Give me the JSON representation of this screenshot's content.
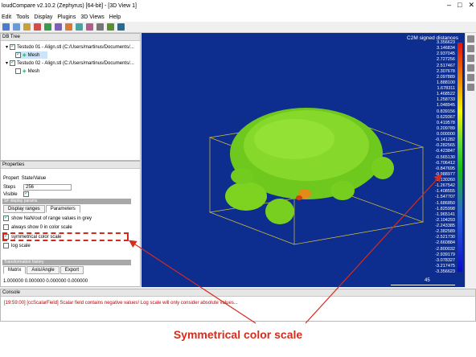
{
  "app": {
    "title": "loudCompare v2.10.2 (Zephyrus) [64-bit] - [3D View 1]",
    "menu": [
      "Edit",
      "Tools",
      "Display",
      "Plugins",
      "3D Views",
      "Help"
    ]
  },
  "db_tree": {
    "title": "DB Tree",
    "items": [
      {
        "label": "Testudo 01 - Align.stl (C:/Users/martinus/Documents/..."
      },
      {
        "label": "Mesh"
      },
      {
        "label": "Testudo 02 - Align.stl (C:/Users/martinus/Documents/..."
      },
      {
        "label": "Mesh"
      }
    ]
  },
  "properties": {
    "title": "Properties",
    "header_col1": "Propert",
    "header_col2": "State/Value",
    "steps_label": "Steps",
    "steps_value": "256",
    "visible_label": "Visible",
    "section_sf": "SF display params",
    "tabs": [
      "Display ranges",
      "Parameters"
    ],
    "options": [
      {
        "label": "show NaN/out of range values in grey",
        "checked": true
      },
      {
        "label": "always show 0 in color scale",
        "checked": false
      },
      {
        "label": "symmetrical color scale",
        "checked": true
      },
      {
        "label": "log scale",
        "checked": false
      }
    ],
    "section_tr": "Transformation history",
    "tr_tabs": [
      "Matrix",
      "Axis/Angle",
      "Export"
    ],
    "matrix_row": "1.000000 0.000000 0.000000 0.000000"
  },
  "view": {
    "scale_title": "C2M signed distances",
    "ticks": [
      "3.356623",
      "3.146834",
      "2.937045",
      "2.727256",
      "2.517467",
      "2.307678",
      "2.097889",
      "1.888100",
      "1.678311",
      "1.468522",
      "1.258733",
      "1.048945",
      "0.839156",
      "0.629367",
      "0.419578",
      "0.209789",
      "0.000000",
      "-0.141282",
      "-0.282565",
      "-0.423847",
      "-0.565130",
      "-0.706412",
      "-0.847695",
      "-0.988977",
      "-1.130260",
      "-1.267542",
      "-1.408555",
      "-1.547707",
      "-1.686850",
      "-1.825998",
      "-1.965141",
      "-2.104293",
      "-2.243385",
      "-2.382589",
      "-2.521730",
      "-2.660884",
      "-2.800032",
      "-2.939179",
      "-3.078327",
      "-3.217475",
      "-3.356623"
    ],
    "zoom_label": "45"
  },
  "console": {
    "title": "Console",
    "message": "[19:59:00] [ccScalarField] Scalar field contains negative values! Log scale will only consider absolute values..."
  },
  "annotation": {
    "caption": "Symmetrical color scale"
  },
  "colors": {
    "view_bg": "#0d2e8f",
    "mesh_green": "#7ed321",
    "annotation_red": "#d72b1c"
  }
}
